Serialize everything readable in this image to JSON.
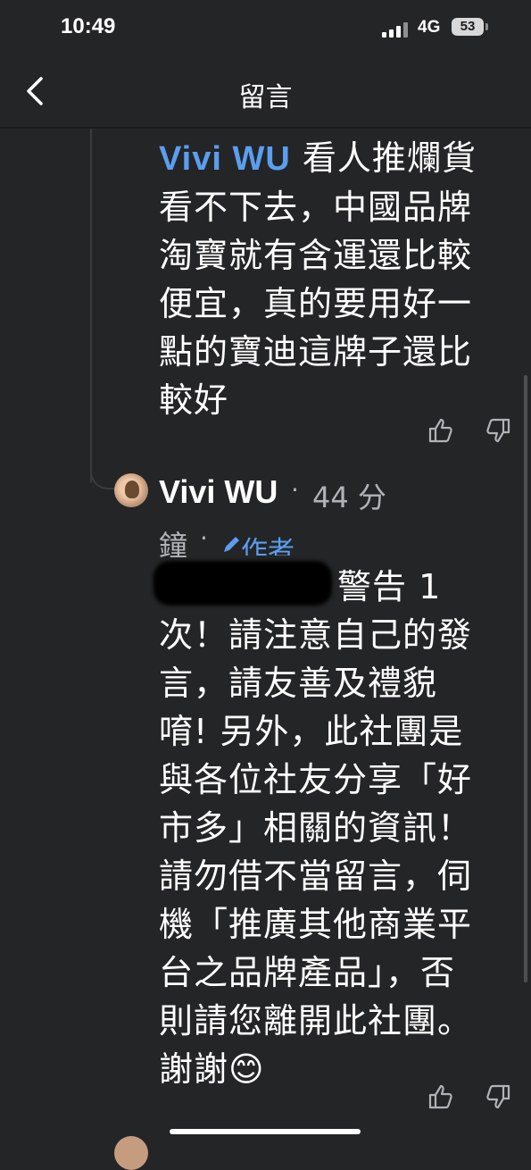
{
  "status_bar": {
    "time": "10:49",
    "network": "4G",
    "battery": "53"
  },
  "header": {
    "title": "留言",
    "back_icon": "chevron-left-icon"
  },
  "reply_comment": {
    "mention": "Vivi WU",
    "lines": [
      " 看人推爛貨",
      "看不下去，中國品牌",
      "淘寶就有含運還比較",
      "便宜，真的要用好一",
      "點的寶迪這牌子還比",
      "較好"
    ],
    "like_icon": "thumbs-up-icon",
    "dislike_icon": "thumbs-down-icon"
  },
  "author_comment": {
    "author": "Vivi WU",
    "time_part1": "44 分",
    "time_part2": "鐘",
    "badge": "作者",
    "first_line_suffix": "警告 1",
    "lines": [
      "次！請注意自己的發",
      "言，請友善及禮貌",
      "唷! 另外，此社團是",
      "與各位社友分享「好",
      "市多」相關的資訊！",
      "請勿借不當留言，伺",
      "機「推廣其他商業平",
      "台之品牌產品」，否",
      "則請您離開此社團。",
      "謝謝"
    ],
    "emoji": "😊",
    "like_icon": "thumbs-up-icon",
    "dislike_icon": "thumbs-down-icon"
  }
}
